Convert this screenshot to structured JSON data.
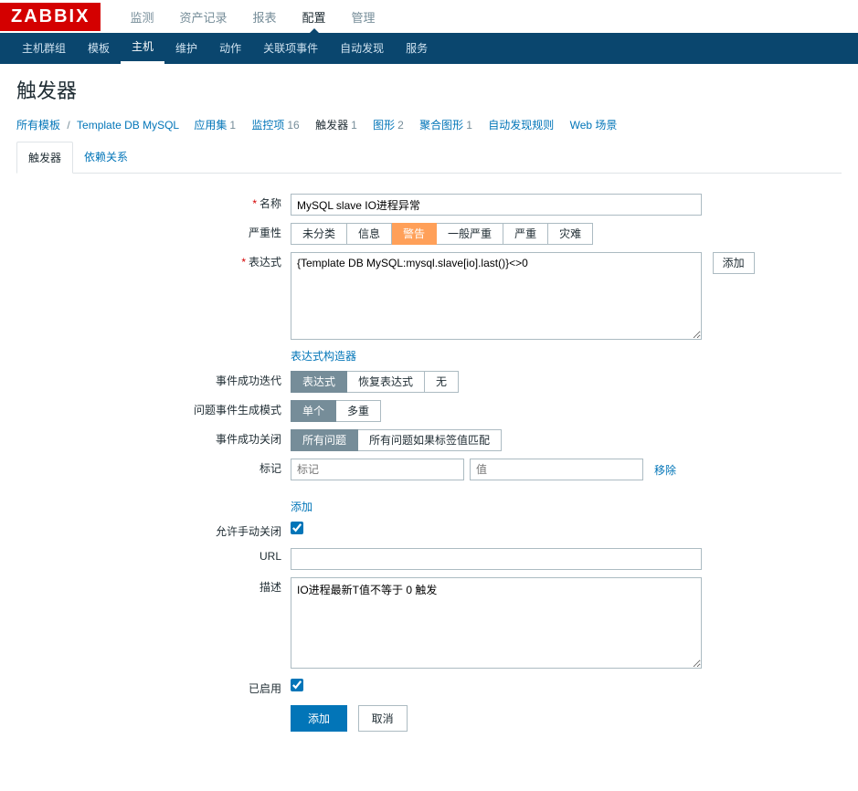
{
  "logo": "ZABBIX",
  "topnav": {
    "items": [
      "监测",
      "资产记录",
      "报表",
      "配置",
      "管理"
    ],
    "active": 3
  },
  "subnav": {
    "items": [
      "主机群组",
      "模板",
      "主机",
      "维护",
      "动作",
      "关联项事件",
      "自动发现",
      "服务"
    ],
    "active": 2
  },
  "page_title": "触发器",
  "breadcrumb": {
    "all_templates": "所有模板",
    "template_name": "Template DB MySQL",
    "items": [
      {
        "label": "应用集",
        "count": "1"
      },
      {
        "label": "监控项",
        "count": "16"
      },
      {
        "label": "触发器",
        "count": "1",
        "active": true
      },
      {
        "label": "图形",
        "count": "2"
      },
      {
        "label": "聚合图形",
        "count": "1"
      },
      {
        "label": "自动发现规则",
        "count": ""
      },
      {
        "label": "Web 场景",
        "count": ""
      }
    ]
  },
  "tabs": {
    "items": [
      "触发器",
      "依赖关系"
    ],
    "active": 0
  },
  "form": {
    "name_label": "名称",
    "name_value": "MySQL slave IO进程异常",
    "severity_label": "严重性",
    "severity_options": [
      "未分类",
      "信息",
      "警告",
      "一般严重",
      "严重",
      "灾难"
    ],
    "severity_selected": 2,
    "expression_label": "表达式",
    "expression_value": "{Template DB MySQL:mysql.slave[io].last()}<>0",
    "expression_add": "添加",
    "expression_builder": "表达式构造器",
    "ok_event_label": "事件成功迭代",
    "ok_event_options": [
      "表达式",
      "恢复表达式",
      "无"
    ],
    "ok_event_selected": 0,
    "problem_mode_label": "问题事件生成模式",
    "problem_mode_options": [
      "单个",
      "多重"
    ],
    "problem_mode_selected": 0,
    "ok_close_label": "事件成功关闭",
    "ok_close_options": [
      "所有问题",
      "所有问题如果标签值匹配"
    ],
    "ok_close_selected": 0,
    "tags_label": "标记",
    "tag_name_ph": "标记",
    "tag_value_ph": "值",
    "tag_remove": "移除",
    "tag_add": "添加",
    "manual_close_label": "允许手动关闭",
    "manual_close_checked": true,
    "url_label": "URL",
    "url_value": "",
    "desc_label": "描述",
    "desc_value": "IO进程最新T值不等于 0 触发",
    "enabled_label": "已启用",
    "enabled_checked": true,
    "submit": "添加",
    "cancel": "取消"
  }
}
